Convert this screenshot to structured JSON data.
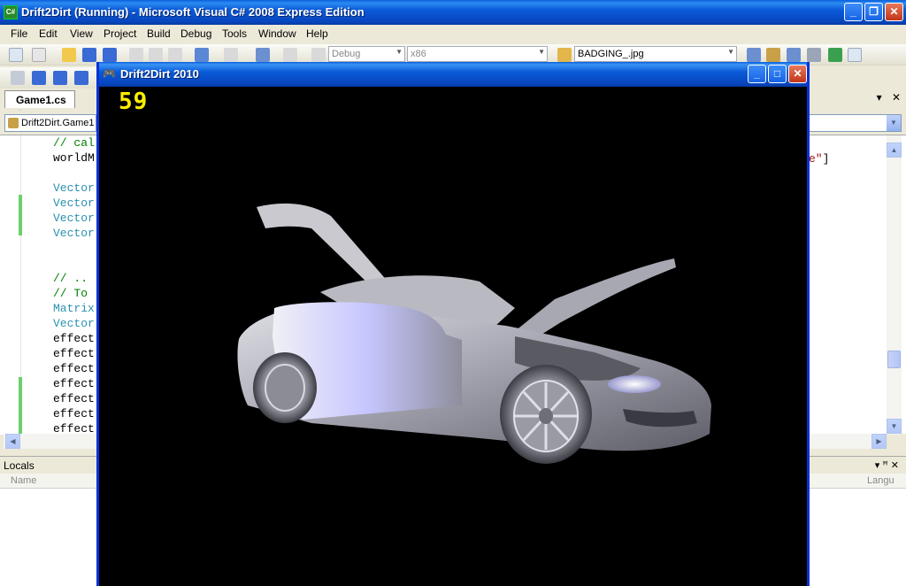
{
  "vs": {
    "title": "Drift2Dirt (Running) - Microsoft Visual C# 2008 Express Edition",
    "app_icon_text": "C#",
    "minimize": "_",
    "maximize": "❐",
    "close": "✕"
  },
  "menu": [
    "File",
    "Edit",
    "View",
    "Project",
    "Build",
    "Debug",
    "Tools",
    "Window",
    "Help"
  ],
  "toolbar": {
    "config": "Debug",
    "platform": "x86",
    "find_combo": "BADGING_.jpg"
  },
  "tab": {
    "label": "Game1.cs",
    "lock": "🔒",
    "dropdown": "▾",
    "close": "✕"
  },
  "nav": {
    "class_combo": "Drift2Dirt.Game1"
  },
  "code": {
    "lines": [
      {
        "text": "// cal",
        "kind": "comment"
      },
      {
        "text": "worldM",
        "kind": "plain"
      },
      {
        "text": "",
        "kind": "plain"
      },
      {
        "text": "Vector",
        "kind": "type"
      },
      {
        "text": "Vector",
        "kind": "type"
      },
      {
        "text": "Vector",
        "kind": "type"
      },
      {
        "text": "Vector",
        "kind": "type"
      },
      {
        "text": "",
        "kind": "plain"
      },
      {
        "text": "",
        "kind": "plain"
      },
      {
        "text": "// ..",
        "kind": "comment"
      },
      {
        "text": "// To",
        "kind": "comment"
      },
      {
        "text": "Matrix",
        "kind": "type"
      },
      {
        "text": "Vector",
        "kind": "type"
      },
      {
        "text": "effect",
        "kind": "plain"
      },
      {
        "text": "effect",
        "kind": "plain"
      },
      {
        "text": "effect",
        "kind": "plain"
      },
      {
        "text": "effect",
        "kind": "plain"
      },
      {
        "text": "effect",
        "kind": "plain"
      },
      {
        "text": "effect",
        "kind": "plain"
      },
      {
        "text": "effect",
        "kind": "plain"
      }
    ],
    "right_fragment": "e\"",
    "right_bracket": "]"
  },
  "locals": {
    "title": "Locals",
    "col_name": "Name",
    "col_lang": "Langu",
    "tools": "▾  ꟸ  ✕"
  },
  "game": {
    "title": "Drift2Dirt 2010",
    "fps": "59",
    "minimize": "_",
    "maximize": "□",
    "close": "✕"
  },
  "colors": {
    "xp_blue": "#0a5ad8",
    "fps_yellow": "#ffee00",
    "code_type": "#2b91af",
    "code_comment": "#008000"
  }
}
